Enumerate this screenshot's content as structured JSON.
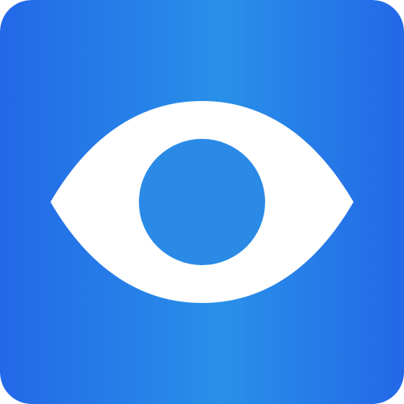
{
  "icon": {
    "name": "eye-icon",
    "colors": {
      "gradient_edge": "#2468E8",
      "gradient_center": "#2890E8",
      "eye_white": "#FFFFFF",
      "pupil": "#2A8AE6"
    }
  }
}
